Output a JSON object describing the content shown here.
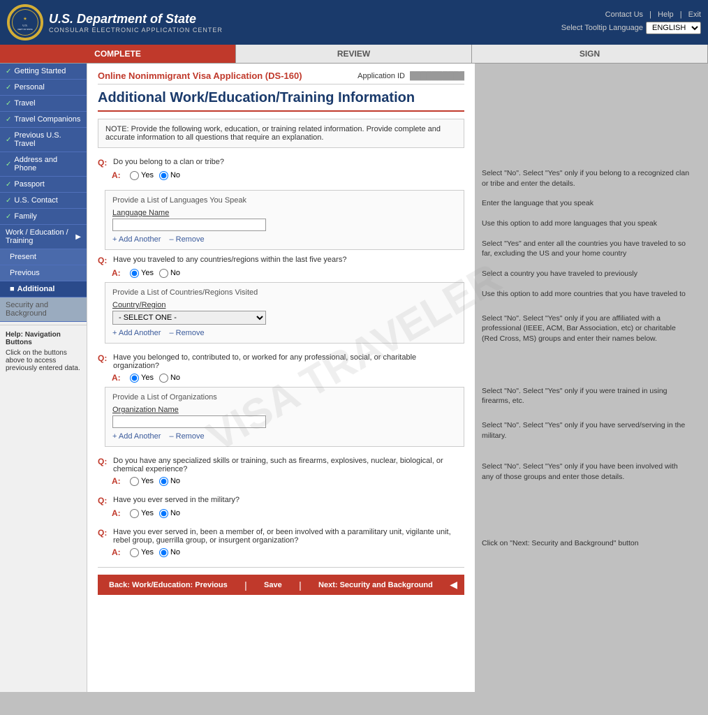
{
  "header": {
    "dept_name": "U.S. Department of State",
    "dept_sub": "CONSULAR ELECTRONIC APPLICATION CENTER",
    "contact_us": "Contact Us",
    "help": "Help",
    "exit": "Exit",
    "select_tooltip_label": "Select Tooltip Language",
    "lang_value": "ENGLISH"
  },
  "progress": {
    "steps": [
      {
        "label": "COMPLETE",
        "active": true
      },
      {
        "label": "REVIEW",
        "active": false
      },
      {
        "label": "SIGN",
        "active": false
      }
    ]
  },
  "form": {
    "title_small": "Online Nonimmigrant Visa Application (DS-160)",
    "app_id_label": "Application ID",
    "app_id_value": "██████████",
    "page_title": "Additional Work/Education/Training Information",
    "note": "NOTE: Provide the following work, education, or training related information. Provide complete and accurate information to all questions that require an explanation."
  },
  "questions": [
    {
      "q": "Do you belong to a clan or tribe?",
      "a_default": "No",
      "options": [
        "Yes",
        "No"
      ]
    },
    {
      "q": "Have you traveled to any countries/regions within the last five years?",
      "a_default": "Yes",
      "options": [
        "Yes",
        "No"
      ],
      "sub_section": {
        "title": "Provide a List of Countries/Regions Visited",
        "field_label": "Country/Region",
        "select_default": "- SELECT ONE -"
      }
    },
    {
      "q": "Have you belonged to, contributed to, or worked for any professional, social, or charitable organization?",
      "a_default": "Yes",
      "options": [
        "Yes",
        "No"
      ],
      "sub_section": {
        "title": "Provide a List of Organizations",
        "field_label": "Organization Name"
      }
    },
    {
      "q": "Do you have any specialized skills or training, such as firearms, explosives, nuclear, biological, or chemical experience?",
      "a_default": "No",
      "options": [
        "Yes",
        "No"
      ]
    },
    {
      "q": "Have you ever served in the military?",
      "a_default": "No",
      "options": [
        "Yes",
        "No"
      ]
    },
    {
      "q": "Have you ever served in, been a member of, or been involved with a paramilitary unit, vigilante unit, rebel group, guerrilla group, or insurgent organization?",
      "a_default": "No",
      "options": [
        "Yes",
        "No"
      ]
    }
  ],
  "languages_section": {
    "title": "Provide a List of Languages You Speak",
    "field_label": "Language Name"
  },
  "buttons": {
    "add_another": "Add Another",
    "remove": "Remove",
    "back": "Back: Work/Education: Previous",
    "save": "Save",
    "next": "Next: Security and Background"
  },
  "sidebar": {
    "items": [
      {
        "label": "Getting Started",
        "checked": true
      },
      {
        "label": "Personal",
        "checked": true
      },
      {
        "label": "Travel",
        "checked": true
      },
      {
        "label": "Travel Companions",
        "checked": true
      },
      {
        "label": "Previous U.S. Travel",
        "checked": true
      },
      {
        "label": "Address and Phone",
        "checked": true
      },
      {
        "label": "Passport",
        "checked": true
      },
      {
        "label": "U.S. Contact",
        "checked": true
      },
      {
        "label": "Family",
        "checked": true
      },
      {
        "label": "Work / Education / Training",
        "checked": false,
        "has_arrow": true
      },
      {
        "label": "Present",
        "sub": true
      },
      {
        "label": "Previous",
        "sub": true
      },
      {
        "label": "Additional",
        "sub": true,
        "current": true
      },
      {
        "label": "Security and Background",
        "checked": false,
        "grayed": true
      }
    ],
    "help": {
      "title": "Help: Navigation Buttons",
      "text": "Click on the buttons above to access previously entered data."
    }
  },
  "annotations": [
    "Select \"No\". Select \"Yes\" only if you belong to a recognized clan or tribe and enter the details.",
    "Enter the language that you speak",
    "Use this option to add more languages that you speak",
    "Select \"Yes\" and enter all the countries you have traveled to so far, excluding the US and your home country",
    "Select a country you have traveled to previously",
    "Use this option to add more countries that you have traveled to",
    "Select \"No\". Select \"Yes\" only if you are affiliated with a professional (IEEE, ACM, Bar Association, etc) or charitable (Red Cross, MS) groups and enter their names below.",
    "Select \"No\". Select \"Yes\" only if you were trained in using firearms, etc.",
    "Select \"No\". Select \"Yes\" only if you have served/serving in the military.",
    "Select \"No\". Select \"Yes\" only if you have been involved with any of those groups and enter those details.",
    "Click on \"Next: Security and Background\" button"
  ]
}
